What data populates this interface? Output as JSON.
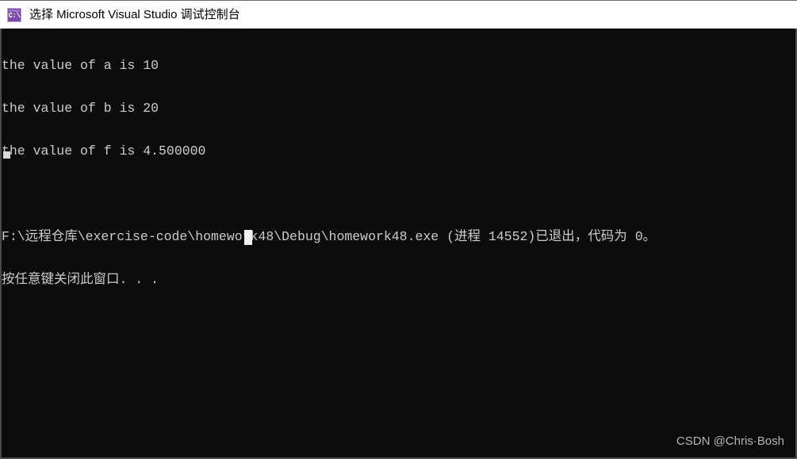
{
  "window": {
    "title": "选择 Microsoft Visual Studio 调试控制台",
    "icon_name": "console-app-icon",
    "icon_glyph": "C:\\",
    "titlebar_bg": "#ffffff",
    "titlebar_fg": "#000000",
    "console_bg": "#0c0c0c",
    "console_fg": "#cccccc",
    "border_color": "#4a4a4a"
  },
  "console": {
    "lines": [
      "the value of a is 10",
      "the value of b is 20",
      "the value of f is 4.500000",
      "",
      "F:\\远程仓库\\exercise-code\\homework48\\Debug\\homework48.exe (进程 14552)已退出，代码为 0。",
      "按任意键关闭此窗口. . ."
    ],
    "values": {
      "a": "10",
      "b": "20",
      "f": "4.500000",
      "process_id": "14552",
      "exit_code": "0",
      "executable_path": "F:\\远程仓库\\exercise-code\\homework48\\Debug\\homework48.exe"
    },
    "caret_name": "text-caret",
    "mouse_cursor_name": "mouse-block-cursor"
  },
  "watermark": {
    "text": "CSDN @Chris·Bosh"
  }
}
